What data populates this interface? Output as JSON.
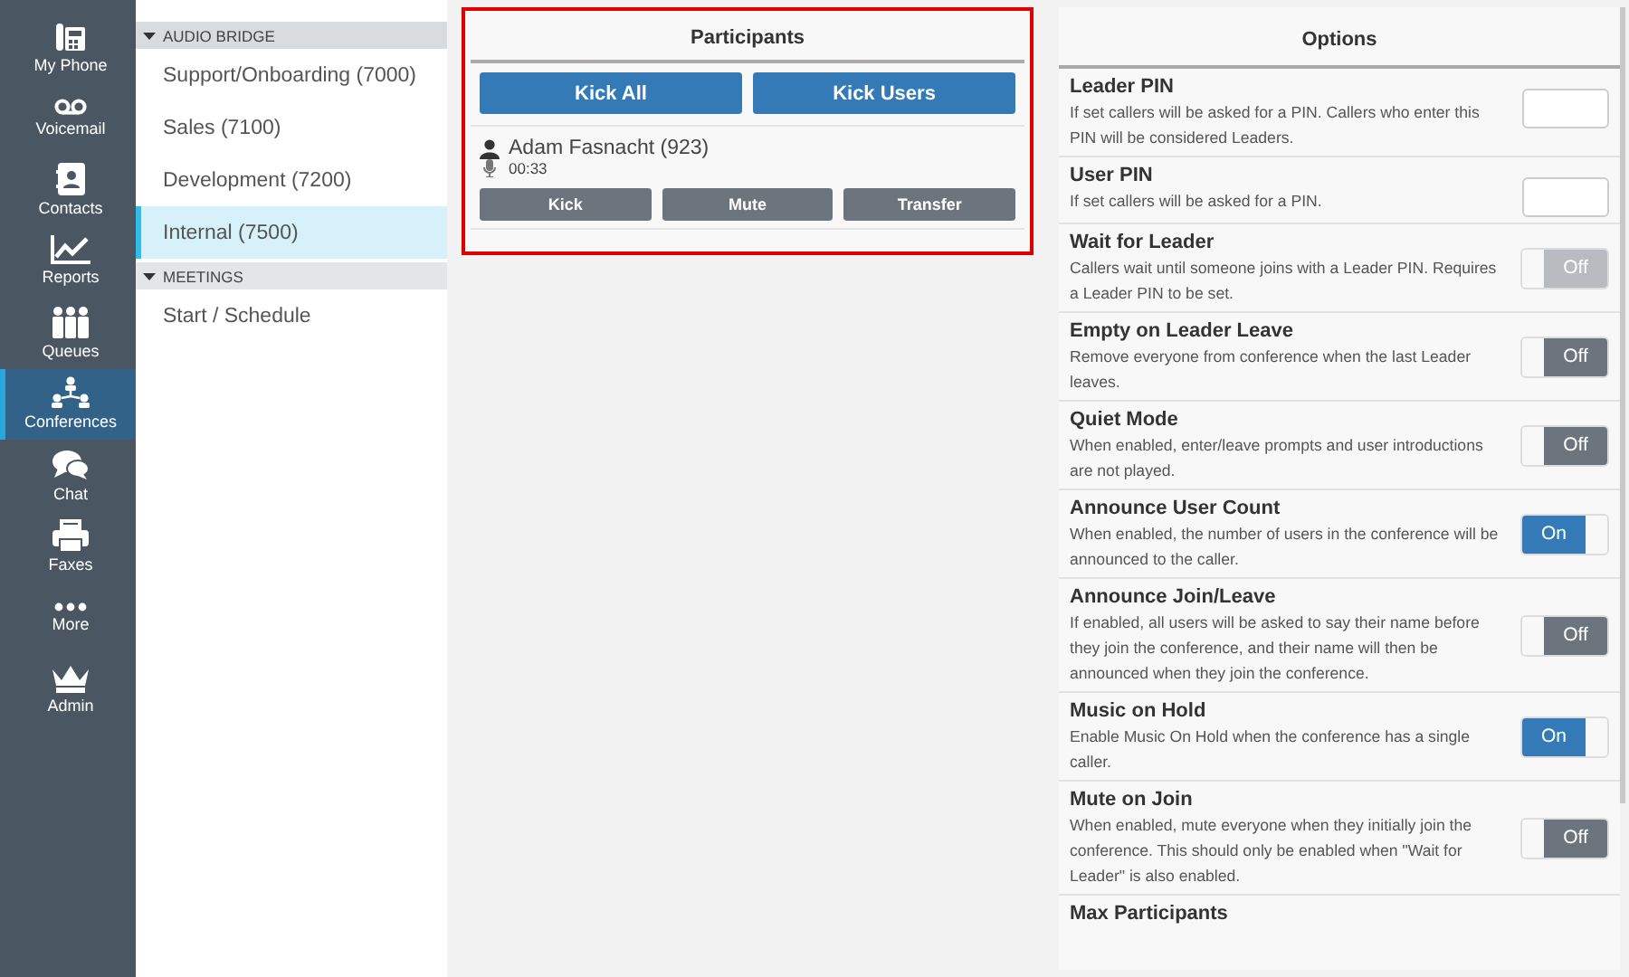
{
  "nav": [
    {
      "label": "My Phone",
      "selected": false
    },
    {
      "label": "Voicemail",
      "selected": false
    },
    {
      "label": "Contacts",
      "selected": false
    },
    {
      "label": "Reports",
      "selected": false
    },
    {
      "label": "Queues",
      "selected": false
    },
    {
      "label": "Conferences",
      "selected": true
    },
    {
      "label": "Chat",
      "selected": false
    },
    {
      "label": "Faxes",
      "selected": false
    },
    {
      "label": "More",
      "selected": false
    },
    {
      "label": "Admin",
      "selected": false
    }
  ],
  "sections": [
    {
      "title": "AUDIO BRIDGE",
      "items": [
        {
          "label": "Support/Onboarding (7000)",
          "selected": false
        },
        {
          "label": "Sales (7100)",
          "selected": false
        },
        {
          "label": "Development (7200)",
          "selected": false
        },
        {
          "label": "Internal (7500)",
          "selected": true
        }
      ]
    },
    {
      "title": "MEETINGS",
      "items": [
        {
          "label": "Start / Schedule",
          "selected": false
        }
      ]
    }
  ],
  "participants": {
    "title": "Participants",
    "buttons": [
      "Kick All",
      "Kick Users"
    ],
    "people": [
      {
        "name": "Adam Fasnacht (923)",
        "duration": "00:33",
        "actions": [
          "Kick",
          "Mute",
          "Transfer"
        ]
      }
    ]
  },
  "options": {
    "title": "Options",
    "items": [
      {
        "kind": "pin",
        "title": "Leader PIN",
        "description": "If set callers will be asked for a PIN. Callers who enter this PIN will be considered Leaders."
      },
      {
        "kind": "pin",
        "title": "User PIN",
        "description": "If set callers will be asked for a PIN."
      },
      {
        "kind": "toggle",
        "title": "Wait for Leader",
        "description": "Callers wait until someone joins with a Leader PIN. Requires a Leader PIN to be set.",
        "on": false,
        "disabled": true,
        "state_label": "Off"
      },
      {
        "kind": "toggle",
        "title": "Empty on Leader Leave",
        "description": "Remove everyone from conference when the last Leader leaves.",
        "on": false,
        "disabled": false,
        "state_label": "Off"
      },
      {
        "kind": "toggle",
        "title": "Quiet Mode",
        "description": "When enabled, enter/leave prompts and user introductions are not played.",
        "on": false,
        "disabled": false,
        "state_label": "Off"
      },
      {
        "kind": "toggle",
        "title": "Announce User Count",
        "description": "When enabled, the number of users in the conference will be announced to the caller.",
        "on": true,
        "disabled": false,
        "state_label": "On"
      },
      {
        "kind": "toggle",
        "title": "Announce Join/Leave",
        "description": "If enabled, all users will be asked to say their name before they join the conference, and their name will then be announced when they join the conference.",
        "on": false,
        "disabled": false,
        "state_label": "Off"
      },
      {
        "kind": "toggle",
        "title": "Music on Hold",
        "description": "Enable Music On Hold when the conference has a single caller.",
        "on": true,
        "disabled": false,
        "state_label": "On"
      },
      {
        "kind": "toggle",
        "title": "Mute on Join",
        "description": "When enabled, mute everyone when they initially join the conference. This should only be enabled when \"Wait for Leader\" is also enabled.",
        "on": false,
        "disabled": false,
        "state_label": "Off"
      },
      {
        "kind": "heading",
        "title": "Max Participants"
      }
    ]
  }
}
